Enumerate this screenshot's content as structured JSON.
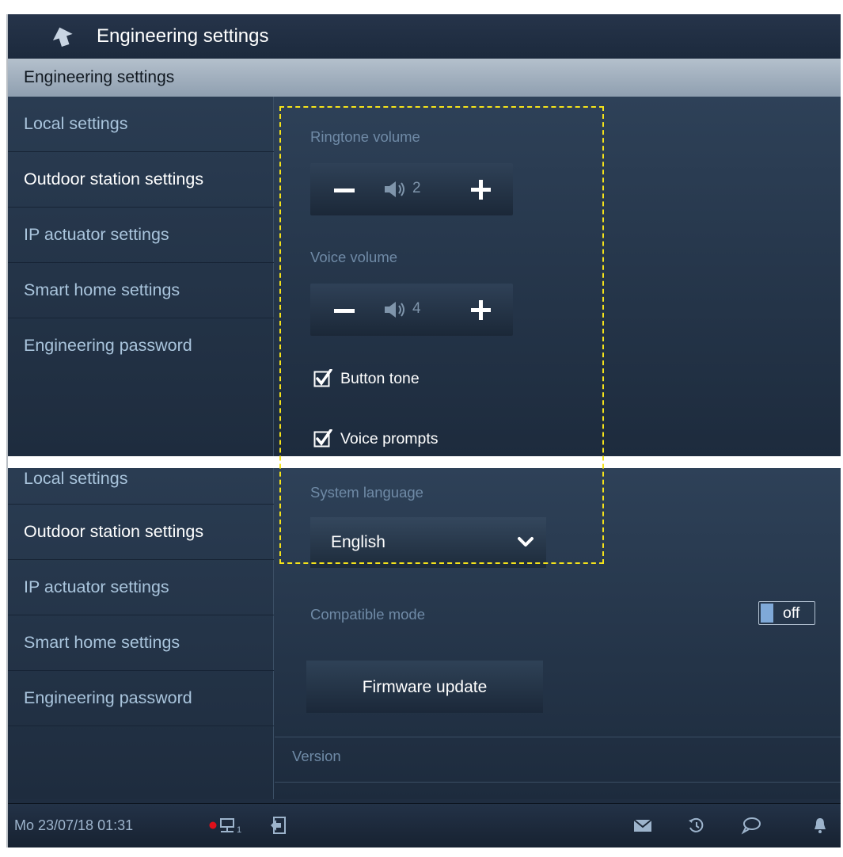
{
  "header": {
    "title": "Engineering settings"
  },
  "subheader": {
    "title": "Engineering settings"
  },
  "sidebar_top": {
    "items": [
      {
        "label": "Local settings"
      },
      {
        "label": "Outdoor station settings"
      },
      {
        "label": "IP actuator settings"
      },
      {
        "label": "Smart home settings"
      },
      {
        "label": "Engineering password"
      }
    ]
  },
  "sidebar_bottom": {
    "partial_label": "Local settings",
    "items": [
      {
        "label": "Outdoor station settings"
      },
      {
        "label": "IP actuator settings"
      },
      {
        "label": "Smart home settings"
      },
      {
        "label": "Engineering password"
      }
    ]
  },
  "ringtone": {
    "label": "Ringtone volume",
    "level": "2"
  },
  "voice": {
    "label": "Voice volume",
    "level": "4"
  },
  "button_tone": {
    "label": "Button tone",
    "checked": true
  },
  "voice_prompts": {
    "label": "Voice prompts",
    "checked": true
  },
  "language": {
    "label": "System language",
    "value": "English"
  },
  "compatible_mode": {
    "label": "Compatible mode",
    "state": "off"
  },
  "firmware": {
    "label": "Firmware update"
  },
  "version": {
    "label": "Version"
  },
  "statusbar": {
    "datetime": "Mo 23/07/18  01:31",
    "network_index": "1",
    "icons": [
      "record-dot-icon",
      "network-icon",
      "logout-icon",
      "mail-icon",
      "history-icon",
      "chat-icon",
      "bell-icon"
    ]
  },
  "colors": {
    "accent": "#7fa9d8",
    "highlight_frame": "#f5e31a",
    "record": "#e0101a"
  }
}
